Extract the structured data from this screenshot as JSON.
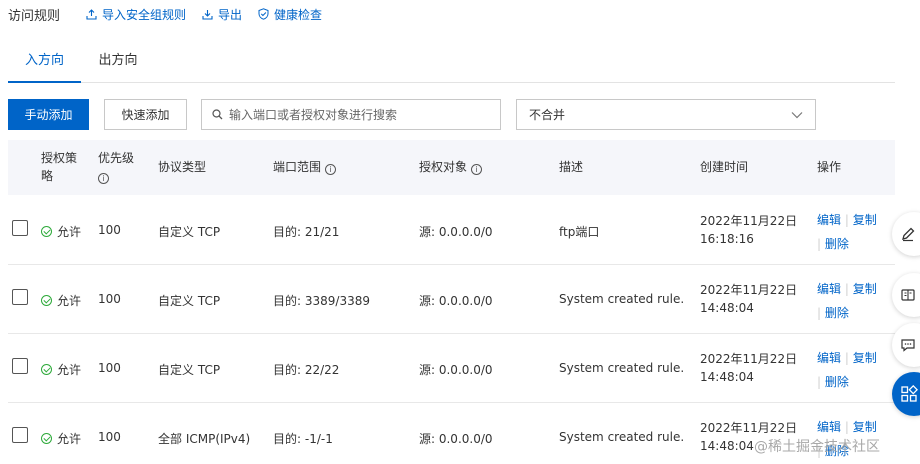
{
  "topbar": {
    "title": "访问规则",
    "import_label": "导入安全组规则",
    "export_label": "导出",
    "health_label": "健康检查"
  },
  "tabs": {
    "inbound": "入方向",
    "outbound": "出方向"
  },
  "toolbar": {
    "manual_add": "手动添加",
    "quick_add": "快速添加",
    "search_placeholder": "输入端口或者授权对象进行搜索",
    "merge_select": "不合并"
  },
  "table": {
    "headers": {
      "policy_line1": "授权策",
      "policy_line2": "略",
      "priority": "优先级",
      "protocol": "协议类型",
      "port_range": "端口范围",
      "auth_object": "授权对象",
      "description": "描述",
      "created_time": "创建时间",
      "actions": "操作"
    },
    "rows": [
      {
        "policy": "允许",
        "priority": "100",
        "protocol": "自定义 TCP",
        "port": "目的: 21/21",
        "source": "源: 0.0.0.0/0",
        "description": "ftp端口",
        "date": "2022年11月22日",
        "time": "16:18:16",
        "edit": "编辑",
        "copy": "复制",
        "delete": "删除"
      },
      {
        "policy": "允许",
        "priority": "100",
        "protocol": "自定义 TCP",
        "port": "目的: 3389/3389",
        "source": "源: 0.0.0.0/0",
        "description": "System created rule.",
        "date": "2022年11月22日",
        "time": "14:48:04",
        "edit": "编辑",
        "copy": "复制",
        "delete": "删除"
      },
      {
        "policy": "允许",
        "priority": "100",
        "protocol": "自定义 TCP",
        "port": "目的: 22/22",
        "source": "源: 0.0.0.0/0",
        "description": "System created rule.",
        "date": "2022年11月22日",
        "time": "14:48:04",
        "edit": "编辑",
        "copy": "复制",
        "delete": "删除"
      },
      {
        "policy": "允许",
        "priority": "100",
        "protocol": "全部 ICMP(IPv4)",
        "port": "目的: -1/-1",
        "source": "源: 0.0.0.0/0",
        "description": "System created rule.",
        "date": "2022年11月22日",
        "time": "14:48:04",
        "edit": "编辑",
        "copy": "复制",
        "delete": "删除"
      }
    ]
  },
  "watermark": "@稀土掘金技术社区",
  "colors": {
    "primary": "#0064c8",
    "allow_green": "#2eaa3b",
    "header_bg": "#f5f6fa"
  }
}
